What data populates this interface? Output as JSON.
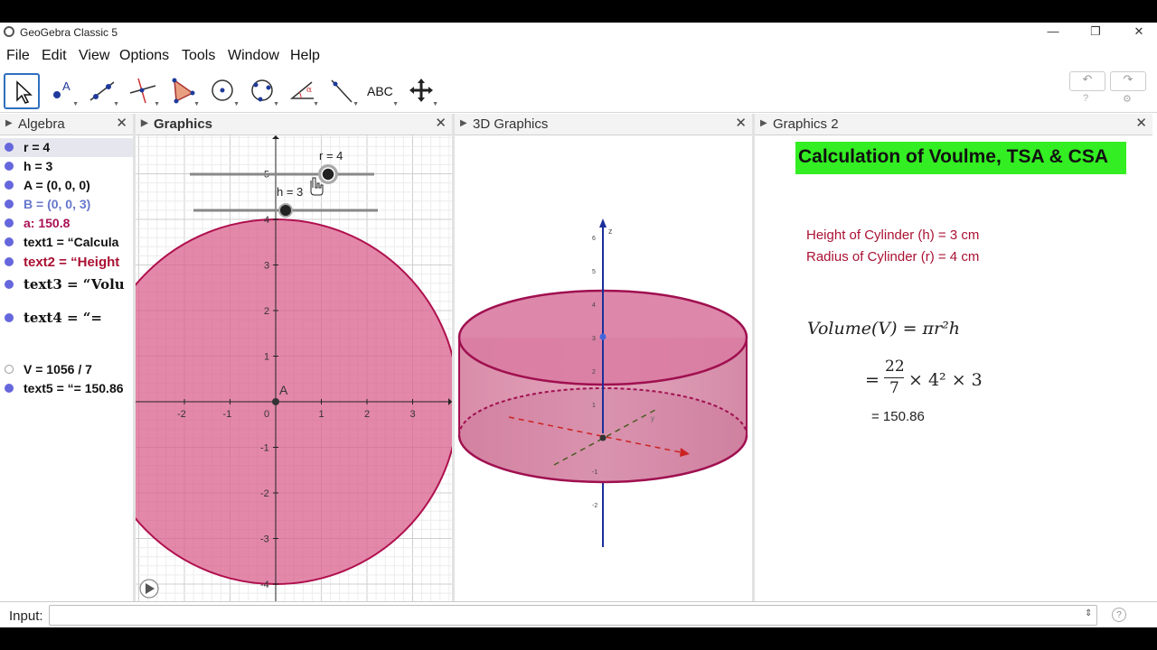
{
  "window": {
    "title": "GeoGebra Classic 5",
    "minimize": "—",
    "restore": "❐",
    "close": "✕"
  },
  "menu": [
    "File",
    "Edit",
    "View",
    "Options",
    "Tools",
    "Window",
    "Help"
  ],
  "toolbar": {
    "tools": [
      "move-tool",
      "point-tool",
      "line-tool",
      "perpendicular-tool",
      "polygon-tool",
      "circle-center-tool",
      "circle-three-points-tool",
      "angle-tool",
      "reflect-tool",
      "text-tool",
      "move-view-tool"
    ],
    "text_tool_label": "ABC",
    "undo": "↶",
    "redo": "↷",
    "help_icon": "?",
    "settings_icon": "⚙"
  },
  "panels": {
    "algebra": {
      "title": "Algebra",
      "close": "✕",
      "arrow": "▶"
    },
    "graphics": {
      "title": "Graphics",
      "close": "✕",
      "arrow": "▶"
    },
    "graphics3d": {
      "title": "3D Graphics",
      "close": "✕",
      "arrow": "▶"
    },
    "graphics2": {
      "title": "Graphics 2",
      "close": "✕",
      "arrow": "▶"
    }
  },
  "algebra": {
    "items": [
      {
        "text": "r = 4",
        "color": "#111111",
        "dot": "#6666dd"
      },
      {
        "text": "h = 3",
        "color": "#111111",
        "dot": "#6666dd"
      },
      {
        "text": "A = (0, 0, 0)",
        "color": "#111111",
        "dot": "#6666dd"
      },
      {
        "text": "B = (0, 0, 3)",
        "color": "#6677cc",
        "dot": "#6666dd"
      },
      {
        "text": "a: 150.8",
        "color": "#aa1155",
        "dot": "#6666dd"
      },
      {
        "text": "text1 = “Calcula",
        "color": "#111111",
        "dot": "#6666dd"
      },
      {
        "text": "text2 = “Height",
        "color": "#aa1133",
        "dot": "#6666dd"
      },
      {
        "text": "text3 = “Volu",
        "color": "#111111",
        "dot": "#6666dd"
      },
      {
        "text": "text4 = “=",
        "color": "#111111",
        "dot": "#6666dd"
      },
      {
        "text": "V = 1056 / 7",
        "color": "#111111",
        "dot": "#ffffff"
      },
      {
        "text": "text5 = “= 150.86",
        "color": "#111111",
        "dot": "#6666dd"
      }
    ]
  },
  "graphics": {
    "slider_r_label": "r = 4",
    "slider_h_label": "h = 3",
    "point_label": "A",
    "x_ticks": [
      "-2",
      "-1",
      "0",
      "1",
      "2",
      "3"
    ],
    "y_ticks": [
      "5",
      "4",
      "3",
      "2",
      "1",
      "-1",
      "-2",
      "-3",
      "-4"
    ],
    "play_icon": "▶",
    "fill_color": "#d9608c",
    "stroke_color": "#b0104e"
  },
  "graphics3d": {
    "axis_label": "z",
    "z_ticks": [
      "6",
      "5",
      "4",
      "3",
      "2",
      "1",
      "-1",
      "-2"
    ],
    "y_label": "y"
  },
  "graphics2": {
    "banner": "Calculation of Voulme, TSA & CSA",
    "height_line": "Height of Cylinder (h) = 3 cm",
    "radius_line": "Radius of Cylinder (r) = 4 cm",
    "volume_formula": "Volume(V) = πr²h",
    "fraction_num": "22",
    "fraction_den": "7",
    "substitution_eq": "=",
    "substitution_rest": "× 4² × 3",
    "result": "= 150.86"
  },
  "input": {
    "label": "Input:",
    "value": "",
    "spin_icon": "⇕",
    "help_icon": "?"
  }
}
